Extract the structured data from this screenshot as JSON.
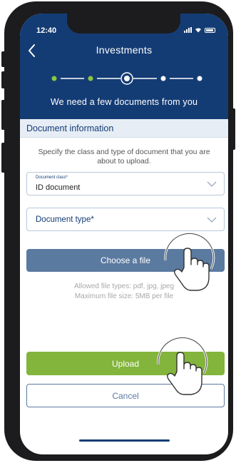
{
  "status_bar": {
    "time": "12:40"
  },
  "header": {
    "title": "Investments",
    "subtitle": "We need a few documents from you",
    "steps": {
      "total": 5,
      "completed": 2,
      "current": 3
    }
  },
  "section": {
    "title": "Document information"
  },
  "intro_text": "Specify the class and type of document that you are about to upload.",
  "document_class": {
    "label": "Document class*",
    "value": "ID document"
  },
  "document_type": {
    "placeholder": "Document type*"
  },
  "choose_file_label": "Choose a file",
  "file_info": {
    "allowed": "Allowed file types: pdf, jpg, jpeg",
    "max_size": "Maximum file size: 5MB per file"
  },
  "upload_label": "Upload",
  "cancel_label": "Cancel",
  "colors": {
    "header_bg": "#143c74",
    "step_done": "#8cc63f",
    "primary_button": "#5b7aa0",
    "upload_button": "#83b43c"
  },
  "icons": [
    "back-arrow-icon",
    "chevron-down-icon",
    "tap-gesture-icon"
  ]
}
